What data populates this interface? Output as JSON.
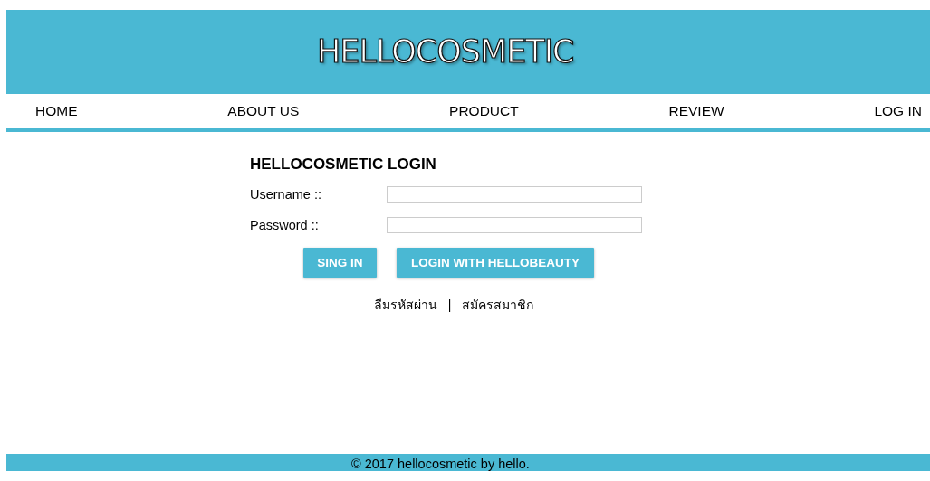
{
  "header": {
    "logo": "HELLOCOSMETIC"
  },
  "nav": [
    {
      "label": "HOME"
    },
    {
      "label": "ABOUT US"
    },
    {
      "label": "PRODUCT"
    },
    {
      "label": "REVIEW"
    },
    {
      "label": "LOG IN"
    }
  ],
  "login": {
    "title": "HELLOCOSMETIC LOGIN",
    "fields": [
      {
        "label": "Username ::"
      },
      {
        "label": "Password ::"
      }
    ],
    "buttons": [
      "SING IN",
      "LOGIN WITH HELLOBEAUTY"
    ],
    "links": [
      "ลืมรหัสผ่าน",
      "สมัครสมาชิก"
    ],
    "separator": "|"
  },
  "footer": {
    "text": "© 2017 hellocosmetic by hello."
  }
}
